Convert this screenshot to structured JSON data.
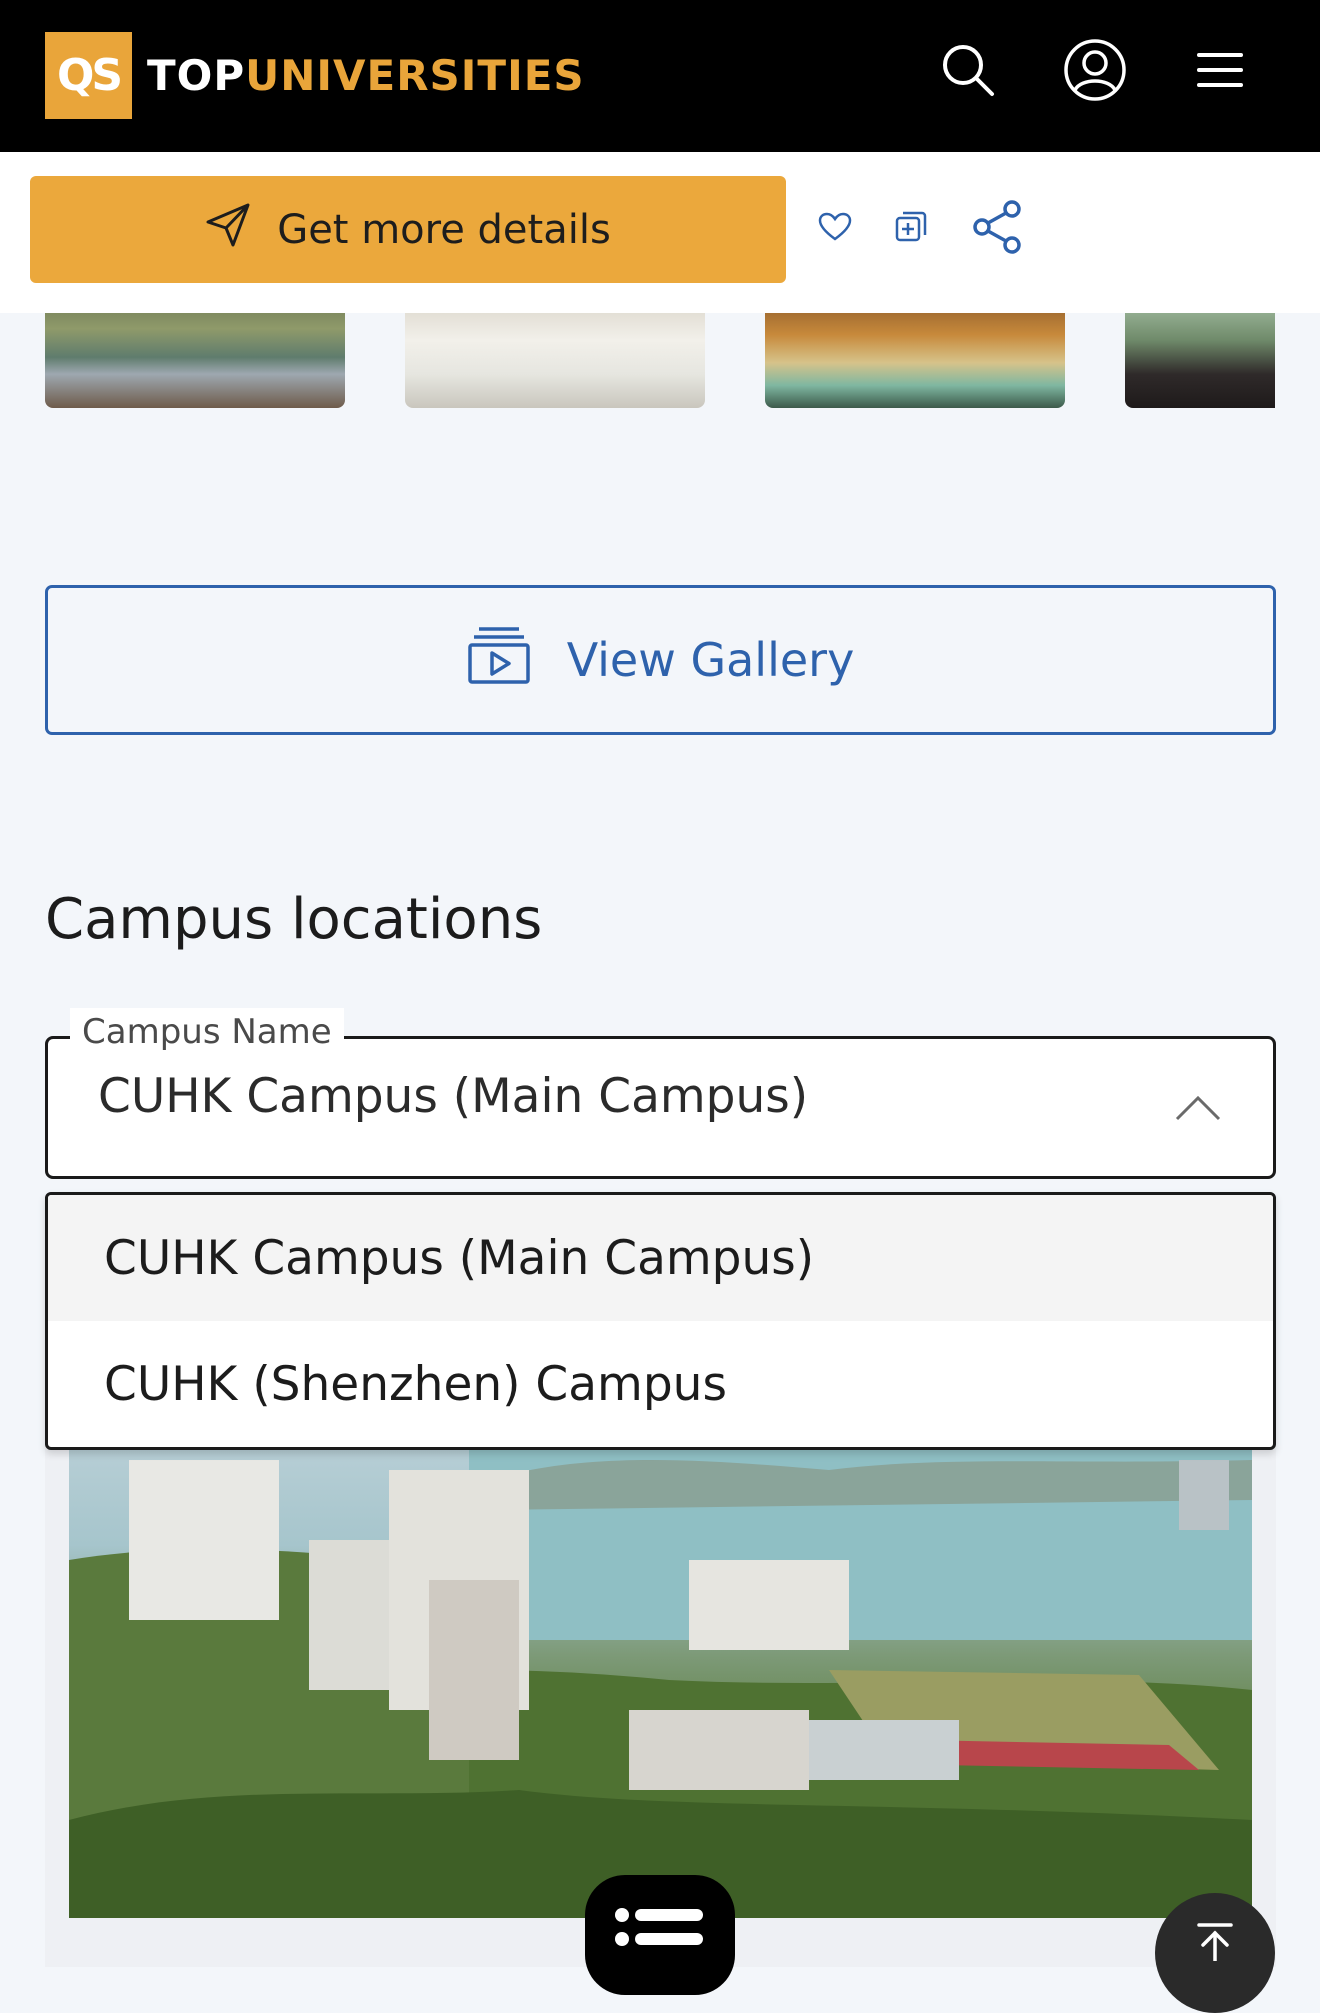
{
  "header": {
    "logo_text": "QS",
    "brand_part1": "TOP",
    "brand_part2": "UNIVERSITIES",
    "icons": [
      "search-icon",
      "user-account-icon",
      "hamburger-menu-icon"
    ]
  },
  "action_bar": {
    "cta_label": "Get more details",
    "icons": [
      "paper-plane-icon",
      "heart-icon",
      "compare-add-icon",
      "share-icon"
    ]
  },
  "gallery": {
    "button_label": "View Gallery",
    "icon": "gallery-play-icon"
  },
  "campus": {
    "title": "Campus locations",
    "select_label": "Campus Name",
    "selected": "CUHK Campus (Main Campus)",
    "options": [
      "CUHK Campus (Main Campus)",
      "CUHK (Shenzhen) Campus"
    ]
  },
  "colors": {
    "brand_orange": "#e9a53a",
    "cta_bg": "#eba83c",
    "link_blue": "#2e62ac",
    "page_bg": "#f3f6fa"
  }
}
